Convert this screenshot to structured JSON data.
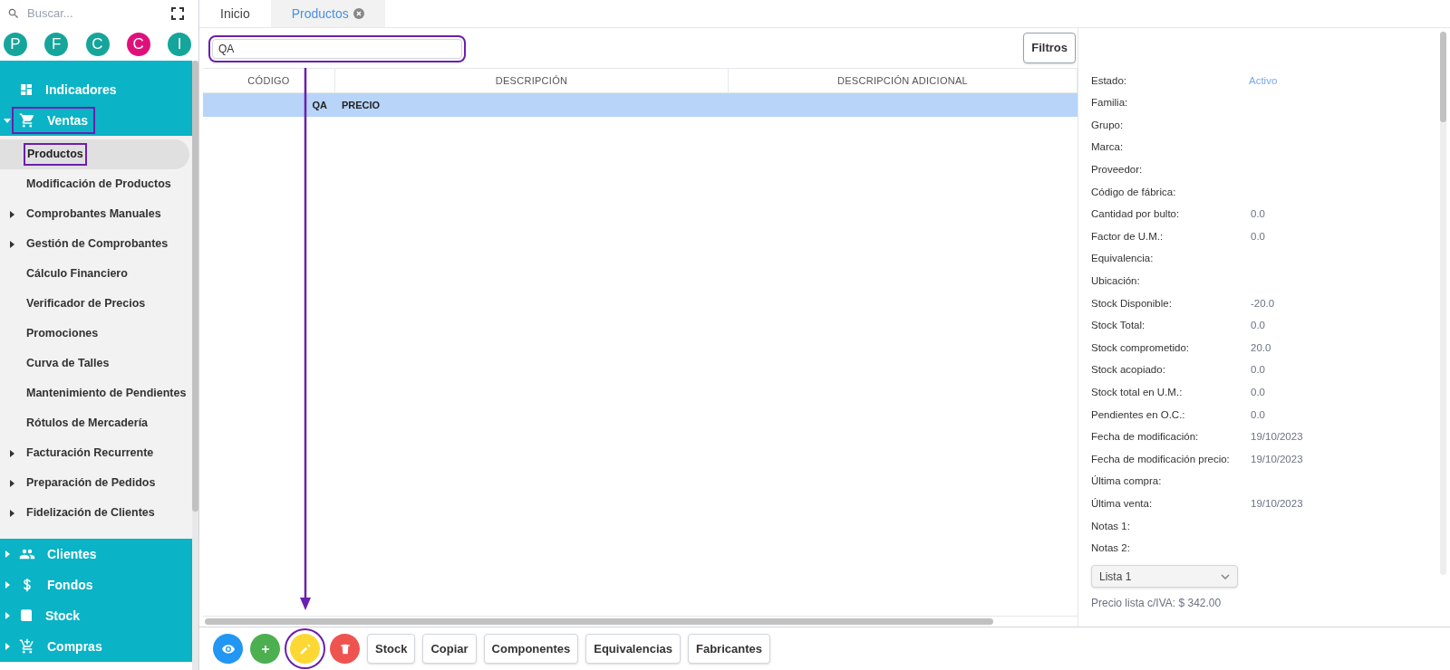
{
  "sidebar": {
    "search": {
      "placeholder": "Buscar..."
    },
    "avatars": [
      {
        "letter": "P",
        "color": "#15a59b"
      },
      {
        "letter": "F",
        "color": "#15a59b"
      },
      {
        "letter": "C",
        "color": "#15a59b"
      },
      {
        "letter": "C",
        "color": "#e0107a"
      },
      {
        "letter": "I",
        "color": "#15a59b"
      }
    ],
    "menu": [
      {
        "label": "Indicadores"
      },
      {
        "label": "Ventas",
        "expanded": true,
        "highlighted": true,
        "children": [
          {
            "label": "Productos",
            "selected": true,
            "highlighted": true
          },
          {
            "label": "Modificación de Productos",
            "selected": false,
            "highlighted": false
          },
          {
            "label": "Comprobantes Manuales",
            "expanded": false,
            "selected": false,
            "highlighted": false
          },
          {
            "label": "Gestión de Comprobantes",
            "expanded": false,
            "selected": false,
            "highlighted": false
          },
          {
            "label": "Cálculo Financiero",
            "selected": false,
            "highlighted": false
          },
          {
            "label": "Verificador de Precios",
            "selected": false,
            "highlighted": false
          },
          {
            "label": "Promociones",
            "selected": false,
            "highlighted": false
          },
          {
            "label": "Curva de Talles",
            "selected": false,
            "highlighted": false
          },
          {
            "label": "Mantenimiento de Pendientes",
            "selected": false,
            "highlighted": false
          },
          {
            "label": "Rótulos de Mercadería",
            "selected": false,
            "highlighted": false
          },
          {
            "label": "Facturación Recurrente",
            "expanded": false,
            "selected": false,
            "highlighted": false
          },
          {
            "label": "Preparación de Pedidos",
            "expanded": false,
            "selected": false,
            "highlighted": false
          },
          {
            "label": "Fidelización de Clientes",
            "expanded": false,
            "selected": false,
            "highlighted": false
          }
        ]
      },
      {
        "label": "Clientes",
        "expanded": false,
        "highlighted": false
      },
      {
        "label": "Fondos",
        "expanded": false,
        "highlighted": false
      },
      {
        "label": "Stock",
        "expanded": false,
        "highlighted": false
      },
      {
        "label": "Compras",
        "expanded": false,
        "highlighted": false
      }
    ]
  },
  "tabs": [
    {
      "label": "Inicio",
      "selected": false
    },
    {
      "label": "Productos",
      "selected": true,
      "closable": true
    }
  ],
  "search": {
    "value": "QA",
    "highlighted": true
  },
  "filters_button": "Filtros",
  "table": {
    "columns": [
      "CÓDIGO",
      "DESCRIPCIÓN",
      "DESCRIPCIÓN ADICIONAL"
    ],
    "rows": [
      {
        "code": "QA",
        "description": "PRECIO",
        "selected": true
      }
    ]
  },
  "details": {
    "fields": [
      {
        "label": "Estado:",
        "value": "Activo",
        "kind": "status"
      },
      {
        "label": "Familia:"
      },
      {
        "label": "Grupo:"
      },
      {
        "label": "Marca:"
      },
      {
        "label": "Proveedor:"
      },
      {
        "label": "Código de fábrica:"
      },
      {
        "label": "Cantidad por bulto:",
        "value": "0.0"
      },
      {
        "label": "Factor de U.M.:",
        "value": "0.0"
      },
      {
        "label": "Equivalencia:"
      },
      {
        "label": "Ubicación:"
      },
      {
        "label": "Stock Disponible:",
        "value": "-20.0"
      },
      {
        "label": "Stock Total:",
        "value": "0.0"
      },
      {
        "label": "Stock comprometido:",
        "value": "20.0"
      },
      {
        "label": "Stock acopiado:",
        "value": "0.0"
      },
      {
        "label": "Stock total en U.M.:",
        "value": "0.0"
      },
      {
        "label": "Pendientes en O.C.:",
        "value": "0.0"
      },
      {
        "label": "Fecha de modificación:",
        "value": "19/10/2023"
      },
      {
        "label": "Fecha de modificación precio:",
        "value": "19/10/2023"
      },
      {
        "label": "Última compra:"
      },
      {
        "label": "Última venta:",
        "value": "19/10/2023"
      },
      {
        "label": "Notas 1:"
      },
      {
        "label": "Notas 2:"
      }
    ],
    "price_list": {
      "value": "Lista 1"
    },
    "price_text": "Precio lista c/IVA: $ 342.00"
  },
  "actions": [
    {
      "kind": "view",
      "color": "#2196f3",
      "highlighted": false
    },
    {
      "kind": "add",
      "color": "#4caf50",
      "highlighted": false
    },
    {
      "kind": "edit",
      "color": "#fdd835",
      "highlighted": true
    },
    {
      "kind": "delete",
      "color": "#ef5350",
      "highlighted": false
    },
    {
      "kind": "text",
      "label": "Stock"
    },
    {
      "kind": "text",
      "label": "Copiar"
    },
    {
      "kind": "text",
      "label": "Componentes"
    },
    {
      "kind": "text",
      "label": "Equivalencias"
    },
    {
      "kind": "text",
      "label": "Fabricantes"
    }
  ],
  "annotations": {
    "arrow": true
  }
}
